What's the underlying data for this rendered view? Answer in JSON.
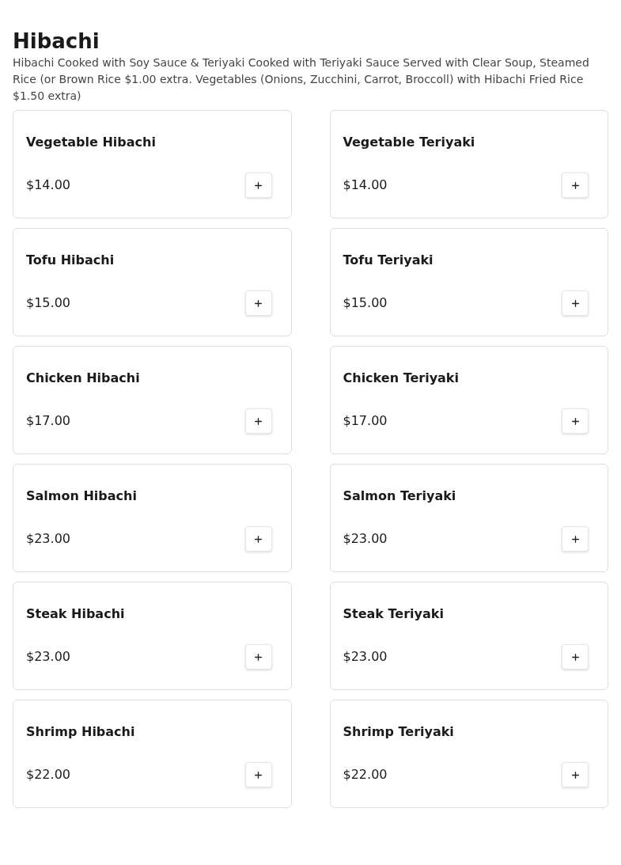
{
  "section": {
    "title": "Hibachi",
    "description": "Hibachi Cooked with Soy Sauce & Teriyaki Cooked with Teriyaki Sauce Served with Clear Soup, Steamed Rice (or Brown Rice $1.00 extra. Vegetables (Onions, Zucchini, Carrot, Broccoll) with Hibachi Fried Rice $1.50 extra)"
  },
  "items": [
    {
      "name": "Vegetable Hibachi",
      "price": "$14.00"
    },
    {
      "name": "Vegetable Teriyaki",
      "price": "$14.00"
    },
    {
      "name": "Tofu Hibachi",
      "price": "$15.00"
    },
    {
      "name": "Tofu Teriyaki",
      "price": "$15.00"
    },
    {
      "name": "Chicken Hibachi",
      "price": "$17.00"
    },
    {
      "name": "Chicken Teriyaki",
      "price": "$17.00"
    },
    {
      "name": "Salmon Hibachi",
      "price": "$23.00"
    },
    {
      "name": "Salmon Teriyaki",
      "price": "$23.00"
    },
    {
      "name": "Steak Hibachi",
      "price": "$23.00"
    },
    {
      "name": "Steak Teriyaki",
      "price": "$23.00"
    },
    {
      "name": "Shrimp Hibachi",
      "price": "$22.00"
    },
    {
      "name": "Shrimp Teriyaki",
      "price": "$22.00"
    }
  ]
}
